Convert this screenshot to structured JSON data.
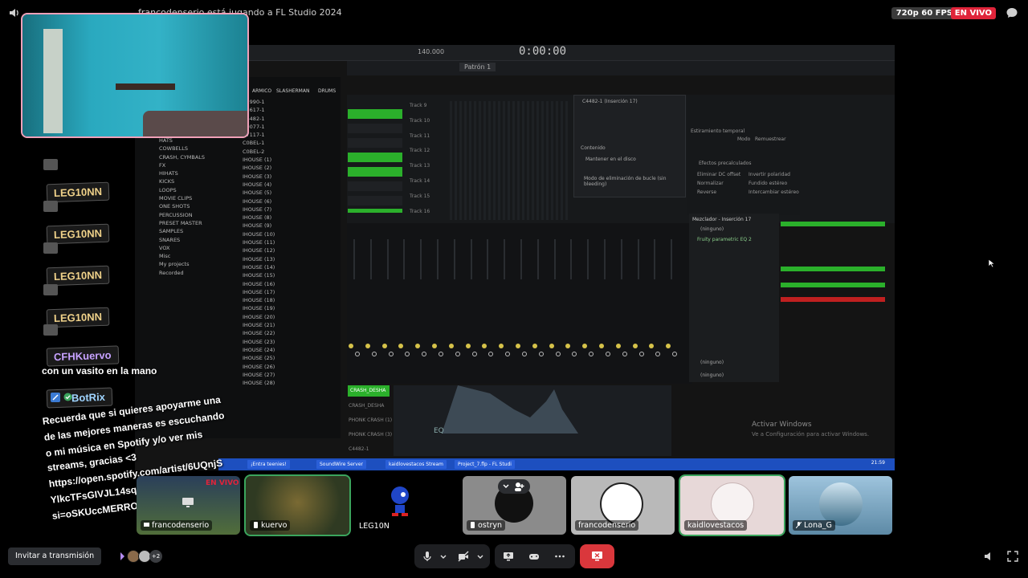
{
  "top": {
    "title": "francodenserio está jugando a FL Studio 2024",
    "quality": "720p 60 FPS",
    "live_badge": "EN VIVO"
  },
  "daw": {
    "time": "0:00:00",
    "pattern": "Patrón 1",
    "tempo": "140.000",
    "browser_headers": [
      "ARMICO",
      "SLASHERMAN",
      "DRUMS"
    ],
    "browser_left": [
      "HATS",
      "COWBELLS",
      "CRASH, CYMBALS",
      "FX",
      "HIHATS",
      "KICKS",
      "LOOPS",
      "MOVIE CLIPS",
      "ONE SHOTS",
      "PERCUSSION",
      "PRESET MASTER",
      "SAMPLES",
      "SNARES",
      "VOX",
      "Misc",
      "My projects",
      "Recorded"
    ],
    "browser_right": [
      "C1990-1",
      "C5617-1",
      "C4482-1",
      "C0077-1",
      "C7117-1",
      "C0BEL-1",
      "C0BEL-2",
      "IHOUSE (1)",
      "IHOUSE (2)",
      "IHOUSE (3)",
      "IHOUSE (4)",
      "IHOUSE (5)",
      "IHOUSE (6)",
      "IHOUSE (7)",
      "IHOUSE (8)",
      "IHOUSE (9)",
      "IHOUSE (10)",
      "IHOUSE (11)",
      "IHOUSE (12)",
      "IHOUSE (13)",
      "IHOUSE (14)",
      "IHOUSE (15)",
      "IHOUSE (16)",
      "IHOUSE (17)",
      "IHOUSE (18)",
      "IHOUSE (19)",
      "IHOUSE (20)",
      "IHOUSE (21)",
      "IHOUSE (22)",
      "IHOUSE (23)",
      "IHOUSE (24)",
      "IHOUSE (25)",
      "IHOUSE (26)",
      "IHOUSE (27)",
      "IHOUSE (28)"
    ],
    "tracks": [
      "Track 9",
      "Track 10",
      "Track 11",
      "Track 12",
      "Track 13",
      "Track 14",
      "Track 15",
      "Track 16"
    ],
    "dialog_title": "C4482-1 (Inserción 17)",
    "dialog_section": "Contenido",
    "dialog_option": "Mantener en el disco",
    "dialog_mode": "Modo de eliminación de bucle (sin bleeding)",
    "fx_title": "Estiramiento temporal",
    "fx_mode": "Modo",
    "fx_mode_val": "Remuestrear",
    "fx_effects": "Efectos precalculados",
    "fx_opts": [
      "Eliminar DC offset",
      "Invertir polaridad",
      "Normalizar",
      "Fundido estéreo",
      "Reverse",
      "Intercambiar estéreo"
    ],
    "insert_title": "Mezclador - Inserción 17",
    "insert_slot": "(ninguno)",
    "insert_plugin": "Fruity parametric EQ 2",
    "side_items": [
      "CRASH_DESHA",
      "CRASH_DESHA",
      "PHONK CRASH (1)",
      "PHONK CRASH (3)",
      "C4482-1"
    ],
    "eq_label": "EQ",
    "windows_activate": "Activar Windows",
    "windows_activate_sub": "Ve a Configuración para activar Windows.",
    "taskbar": [
      "¡Entra teenies!",
      "SoundWire Server",
      "kaidlovestacos Stream",
      "Project_7.flp - FL Studi"
    ],
    "clock": "21:59"
  },
  "chat": {
    "names": [
      "LEG10NN",
      "LEG10NN",
      "LEG10NN",
      "LEG10NN",
      "CFHKuervo",
      "BotRix"
    ],
    "msg_kuervo": "con un vasito en la mano",
    "msg_bot": [
      "Recuerda que si quieres apoyarme una",
      "de las mejores maneras es escuchando",
      "o mi música en Spotify y/o ver mis",
      "streams, gracias <3",
      "https://open.spotify.com/artist/6UQnjS",
      "YlkcTFsGIVJL14sq?",
      "si=oSKUccMERRO2lc8sZNdM6Q"
    ]
  },
  "participants": [
    {
      "name": "francodenserio",
      "live": "EN VIVO"
    },
    {
      "name": "kuervo"
    },
    {
      "name": "LEG10N"
    },
    {
      "name": "ostryn"
    },
    {
      "name": "francodenserio"
    },
    {
      "name": "kaidlovestacos"
    },
    {
      "name": "Lona_G"
    }
  ],
  "bottom": {
    "invite": "Invitar a transmisión",
    "viewer_extra": "+2"
  },
  "colors": {
    "live": "#e0243a",
    "leave": "#da373c",
    "speaking": "#3ba55d",
    "fl_green": "#2bb02b"
  }
}
